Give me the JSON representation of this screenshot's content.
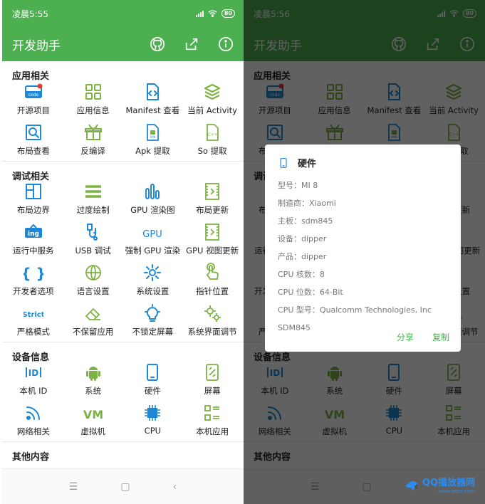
{
  "colors": {
    "primary": "#4caf50",
    "icon_blue": "#1e88d6",
    "icon_green": "#7cb342",
    "dim": "rgba(0,0,0,0.62)"
  },
  "left": {
    "status_time": "凌晨5:55",
    "battery": "80",
    "app_title": "开发助手",
    "toolbar_icons": [
      "github-icon",
      "share-icon",
      "info-icon"
    ],
    "sections": [
      {
        "title": "应用相关",
        "items": [
          {
            "label": "开源项目",
            "icon": "code-icon"
          },
          {
            "label": "应用信息",
            "icon": "grid-apps-icon"
          },
          {
            "label": "Manifest 查看",
            "icon": "xml-file-icon"
          },
          {
            "label": "当前 Activity",
            "icon": "layers-icon"
          },
          {
            "label": "布局查看",
            "icon": "search-frame-icon"
          },
          {
            "label": "反编译",
            "icon": "gift-box-icon"
          },
          {
            "label": "Apk 提取",
            "icon": "apk-file-icon"
          },
          {
            "label": "So 提取",
            "icon": "cpp-file-icon"
          }
        ]
      },
      {
        "title": "调试相关",
        "items": [
          {
            "label": "布局边界",
            "icon": "layout-bounds-icon"
          },
          {
            "label": "过度绘制",
            "icon": "hamburger-icon"
          },
          {
            "label": "GPU 渲染图",
            "icon": "bars-icon"
          },
          {
            "label": "布局更新",
            "icon": "film-icon"
          },
          {
            "label": "运行中服务",
            "icon": "ing-icon"
          },
          {
            "label": "USB 调试",
            "icon": "usb-icon"
          },
          {
            "label": "强制 GPU 渲染",
            "icon": "gpu-text-icon"
          },
          {
            "label": "GPU 视图更新",
            "icon": "gpu-film-icon"
          },
          {
            "label": "开发者选项",
            "icon": "braces-icon"
          },
          {
            "label": "语言设置",
            "icon": "globe-icon"
          },
          {
            "label": "系统设置",
            "icon": "gear-icon"
          },
          {
            "label": "指针位置",
            "icon": "pointer-hand-icon"
          },
          {
            "label": "严格模式",
            "icon": "strict-text-icon"
          },
          {
            "label": "不保留应用",
            "icon": "eraser-icon"
          },
          {
            "label": "不锁定屏幕",
            "icon": "bulb-icon"
          },
          {
            "label": "系统界面调节",
            "icon": "gears-icon"
          }
        ]
      },
      {
        "title": "设备信息",
        "items": [
          {
            "label": "本机 ID",
            "icon": "id-icon"
          },
          {
            "label": "系统",
            "icon": "android-icon"
          },
          {
            "label": "硬件",
            "icon": "phone-icon"
          },
          {
            "label": "屏幕",
            "icon": "screen-icon"
          },
          {
            "label": "网络相关",
            "icon": "rss-icon"
          },
          {
            "label": "虚拟机",
            "icon": "vm-icon"
          },
          {
            "label": "CPU",
            "icon": "cpu-icon"
          },
          {
            "label": "本机应用",
            "icon": "app-list-icon"
          }
        ]
      },
      {
        "title": "其他内容",
        "items": []
      }
    ]
  },
  "right": {
    "status_time": "凌晨5:56",
    "battery": "80",
    "dialog": {
      "title": "硬件",
      "lines": [
        "型号：MI 8",
        "制造商：Xiaomi",
        "主板：sdm845",
        "设备：dipper",
        "产品：dipper",
        "CPU 核数：8",
        "CPU 位数：64-Bit",
        "CPU 型号：Qualcomm Technologies, Inc",
        "SDM845"
      ],
      "share_label": "分享",
      "copy_label": "复制"
    },
    "watermark_main": "QQ播放器网",
    "watermark_sub": "www.qqtn.com"
  }
}
